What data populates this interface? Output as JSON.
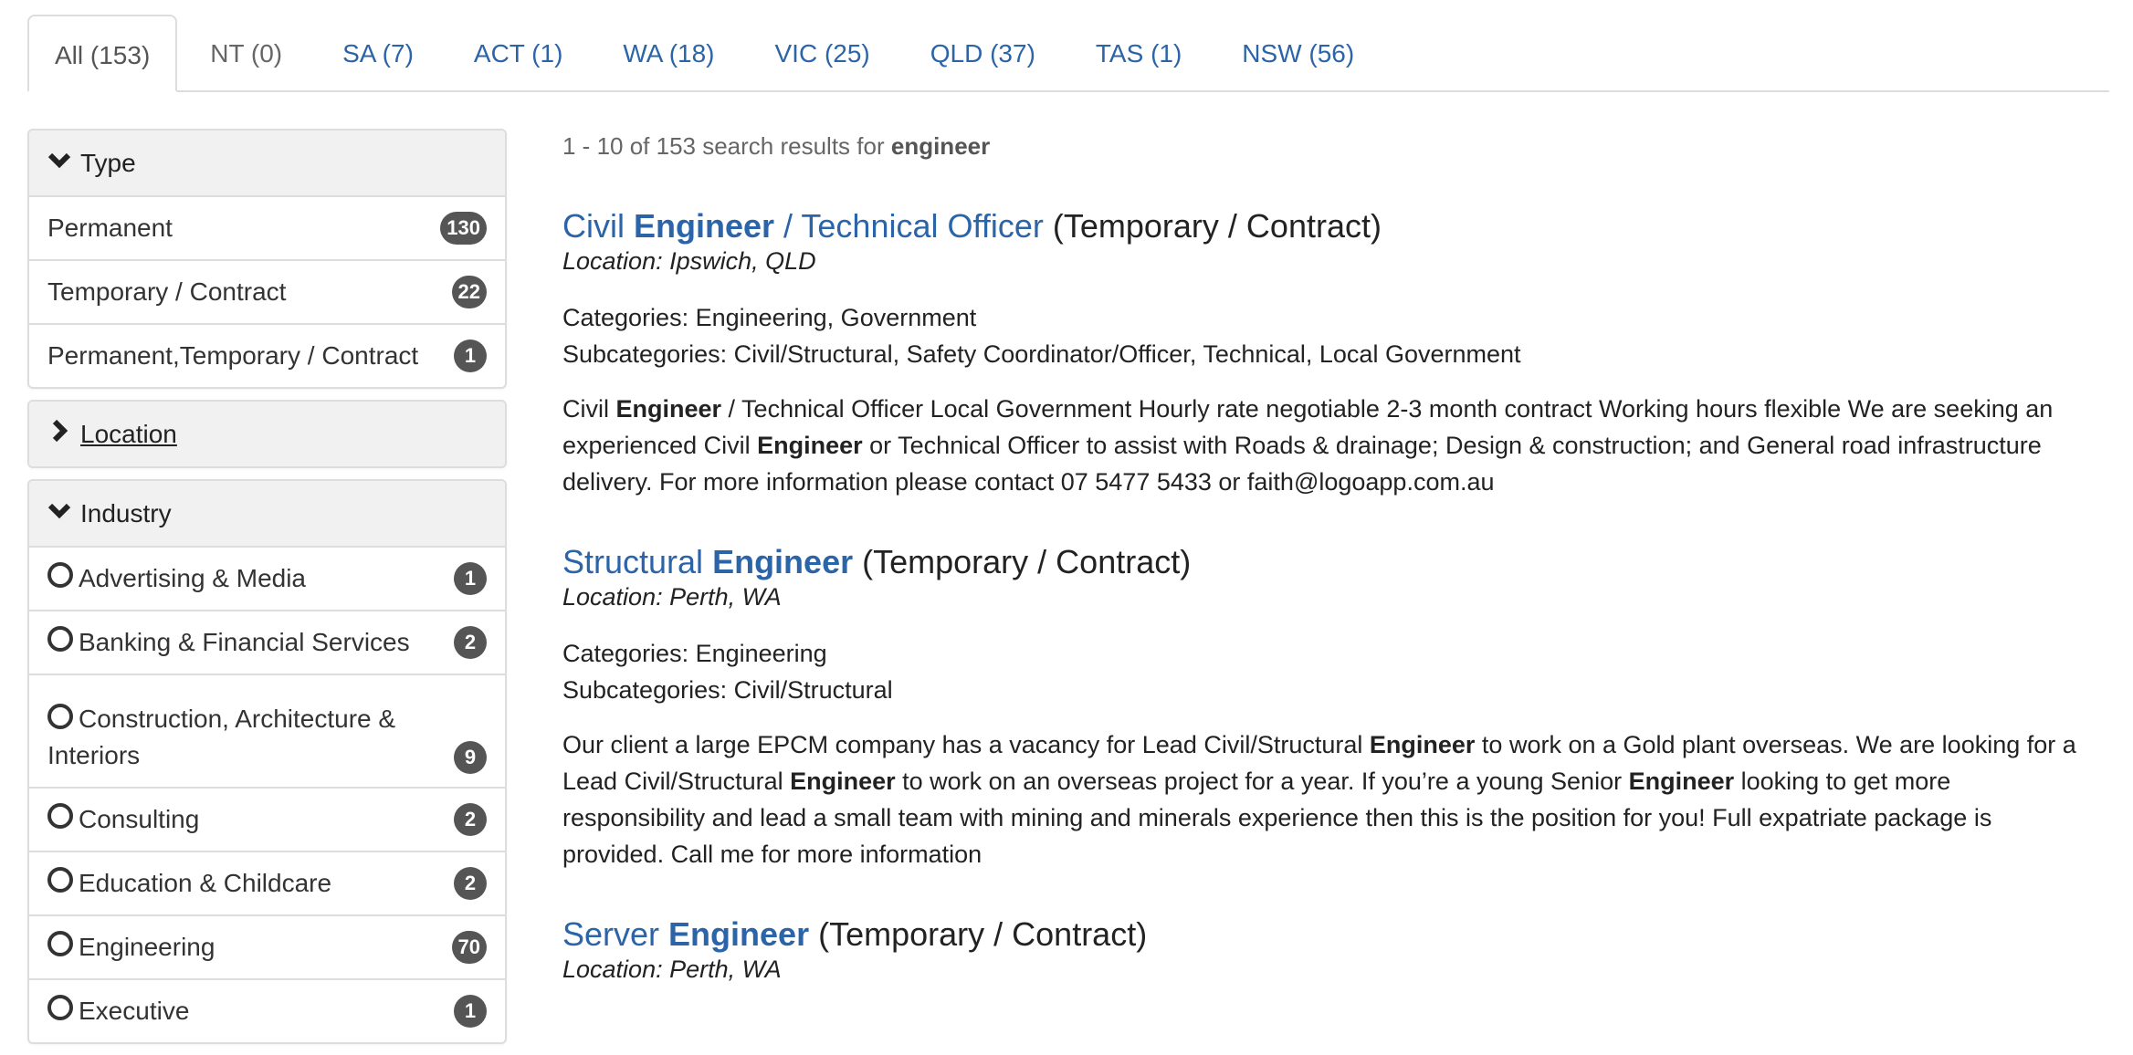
{
  "tabs": [
    {
      "label": "All (153)",
      "state": "active"
    },
    {
      "label": "NT (0)",
      "state": "disabled"
    },
    {
      "label": "SA (7)",
      "state": "link"
    },
    {
      "label": "ACT (1)",
      "state": "link"
    },
    {
      "label": "WA (18)",
      "state": "link"
    },
    {
      "label": "VIC (25)",
      "state": "link"
    },
    {
      "label": "QLD (37)",
      "state": "link"
    },
    {
      "label": "TAS (1)",
      "state": "link"
    },
    {
      "label": "NSW (56)",
      "state": "link"
    }
  ],
  "sidebar": {
    "type": {
      "heading": "Type",
      "icon": "chevron-down-icon",
      "items": [
        {
          "label": "Permanent",
          "count": "130"
        },
        {
          "label": "Temporary / Contract",
          "count": "22"
        },
        {
          "label": "Permanent,Temporary / Contract",
          "count": "1"
        }
      ]
    },
    "location": {
      "heading": "Location",
      "icon": "chevron-right-icon"
    },
    "industry": {
      "heading": "Industry",
      "icon": "chevron-down-icon",
      "items": [
        {
          "label": "Advertising & Media",
          "count": "1"
        },
        {
          "label": "Banking & Financial Services",
          "count": "2"
        },
        {
          "label": "Construction, Architecture & Interiors",
          "count": "9"
        },
        {
          "label": "Consulting",
          "count": "2"
        },
        {
          "label": "Education & Childcare",
          "count": "2"
        },
        {
          "label": "Engineering",
          "count": "70"
        },
        {
          "label": "Executive",
          "count": "1"
        }
      ]
    }
  },
  "summary": {
    "prefix": "1 - 10 of 153 search results for ",
    "query": "engineer"
  },
  "results": [
    {
      "title": "Civil Engineer / Technical Officer",
      "title_parts": [
        "Civil ",
        "Engineer",
        " / Technical Officer"
      ],
      "type": "(Temporary / Contract)",
      "location": "Location: Ipswich, QLD",
      "categories": "Categories: Engineering, Government",
      "subcategories": "Subcategories: Civil/Structural, Safety Coordinator/Officer, Technical, Local Government",
      "description": [
        {
          "t": "Civil ",
          "b": false
        },
        {
          "t": "Engineer",
          "b": true
        },
        {
          "t": " / Technical Officer Local Government Hourly rate negotiable 2-3 month contract Working hours flexible We are seeking an experienced Civil ",
          "b": false
        },
        {
          "t": "Engineer",
          "b": true
        },
        {
          "t": " or Technical Officer to assist with Roads & drainage; Design & construction; and General road infrastructure delivery. For more information please contact 07 5477 5433 or faith@logoapp.com.au",
          "b": false
        }
      ]
    },
    {
      "title": "Structural Engineer",
      "title_parts": [
        "Structural ",
        "Engineer",
        ""
      ],
      "type": "(Temporary / Contract)",
      "location": "Location: Perth, WA",
      "categories": "Categories: Engineering",
      "subcategories": "Subcategories: Civil/Structural",
      "description": [
        {
          "t": "Our client a large EPCM company has a vacancy for Lead Civil/Structural ",
          "b": false
        },
        {
          "t": "Engineer",
          "b": true
        },
        {
          "t": " to work on a Gold plant overseas. We are looking for a Lead Civil/Structural ",
          "b": false
        },
        {
          "t": "Engineer",
          "b": true
        },
        {
          "t": " to work on an overseas project for a year. If you’re a young Senior ",
          "b": false
        },
        {
          "t": "Engineer",
          "b": true
        },
        {
          "t": " looking to get more responsibility and lead a small team with mining and minerals experience then this is the position for you! Full expatriate package is provided. Call me for more information",
          "b": false
        }
      ]
    },
    {
      "title": "Server Engineer",
      "title_parts": [
        "Server ",
        "Engineer",
        ""
      ],
      "type": "(Temporary / Contract)",
      "location": "Location: Perth, WA"
    }
  ],
  "colors": {
    "link": "#2c64a8",
    "badge": "#555555",
    "panel_heading": "#f1f1f1",
    "border": "#dddddd"
  }
}
